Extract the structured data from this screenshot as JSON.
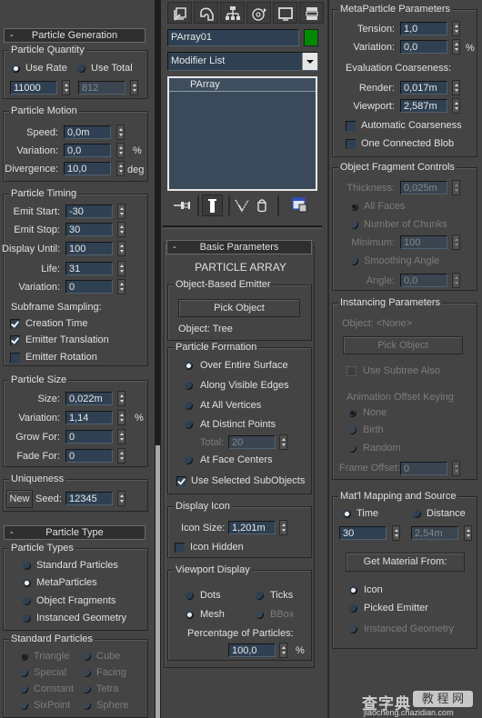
{
  "command_tabs": [
    {
      "name": "create-tab",
      "icon": "create-icon"
    },
    {
      "name": "modify-tab",
      "icon": "modify-icon"
    },
    {
      "name": "hierarchy-tab",
      "icon": "hierarchy-icon"
    },
    {
      "name": "motion-tab",
      "icon": "motion-icon"
    },
    {
      "name": "display-tab",
      "icon": "display-icon"
    },
    {
      "name": "utilities-tab",
      "icon": "utilities-icon"
    }
  ],
  "object": {
    "name": "PArray01",
    "color": "#008a00"
  },
  "modifier_list": {
    "label": "Modifier List"
  },
  "modifier_stack": {
    "items": [
      "PArray"
    ]
  },
  "stack_toolbar": [
    "pin-stack-icon",
    "show-end-result-icon",
    "make-unique-icon",
    "remove-modifier-icon",
    "configure-modifier-sets-icon"
  ],
  "particle_generation": {
    "title": "Particle Generation",
    "collapse": "-",
    "quantity": {
      "title": "Particle Quantity",
      "use_rate": "Use Rate",
      "use_total": "Use Total",
      "rate_value": "11000",
      "total_value": "812",
      "selected": "use_rate"
    },
    "motion": {
      "title": "Particle Motion",
      "speed_label": "Speed:",
      "speed": "0,0m",
      "variation_label": "Variation:",
      "variation": "0,0",
      "variation_unit": "%",
      "divergence_label": "Divergence:",
      "divergence": "10,0",
      "divergence_unit": "deg"
    },
    "timing": {
      "title": "Particle Timing",
      "emit_start_label": "Emit Start:",
      "emit_start": "-30",
      "emit_stop_label": "Emit Stop:",
      "emit_stop": "30",
      "display_until_label": "Display Until:",
      "display_until": "100",
      "life_label": "Life:",
      "life": "31",
      "variation_label": "Variation:",
      "variation": "0",
      "subframe_label": "Subframe Sampling:",
      "creation_time": "Creation Time",
      "creation_time_checked": true,
      "emitter_translation": "Emitter Translation",
      "emitter_translation_checked": true,
      "emitter_rotation": "Emitter Rotation",
      "emitter_rotation_checked": false
    },
    "size": {
      "title": "Particle Size",
      "size_label": "Size:",
      "size": "0,022m",
      "variation_label": "Variation:",
      "variation": "1,14",
      "variation_unit": "%",
      "grow_label": "Grow For:",
      "grow": "0",
      "fade_label": "Fade For:",
      "fade": "0"
    },
    "uniqueness": {
      "title": "Uniqueness",
      "new_label": "New",
      "seed_label": "Seed:",
      "seed": "12345"
    }
  },
  "particle_type": {
    "title": "Particle Type",
    "collapse": "-",
    "types": {
      "title": "Particle Types",
      "options": [
        "Standard Particles",
        "MetaParticles",
        "Object Fragments",
        "Instanced Geometry"
      ],
      "selected": "MetaParticles"
    },
    "standard": {
      "title": "Standard Particles",
      "options": [
        "Triangle",
        "Cube",
        "Special",
        "Facing",
        "Constant",
        "Tetra",
        "SixPoint",
        "Sphere"
      ],
      "selected": "Triangle"
    }
  },
  "basic_parameters": {
    "title": "Basic Parameters",
    "collapse": "-",
    "heading": "PARTICLE ARRAY",
    "emitter": {
      "title": "Object-Based Emitter",
      "pick_label": "Pick Object",
      "object_text": "Object: Tree"
    },
    "formation": {
      "title": "Particle Formation",
      "options": [
        "Over Entire Surface",
        "Along Visible Edges",
        "At All Vertices",
        "At Distinct Points",
        "At Face Centers"
      ],
      "selected": "Over Entire Surface",
      "total_label": "Total:",
      "total": "20",
      "use_selected": "Use Selected SubObjects",
      "use_selected_checked": true
    },
    "display_icon": {
      "title": "Display Icon",
      "icon_size_label": "Icon Size:",
      "icon_size": "1,201m",
      "icon_hidden": "Icon Hidden",
      "icon_hidden_checked": false
    },
    "viewport_display": {
      "title": "Viewport Display",
      "options": [
        "Dots",
        "Ticks",
        "Mesh",
        "BBox"
      ],
      "selected": "Mesh",
      "percentage_label": "Percentage of Particles:",
      "percentage": "100,0",
      "percentage_unit": "%"
    }
  },
  "metaparticle": {
    "title": "MetaParticle Parameters",
    "tension_label": "Tension:",
    "tension": "1,0",
    "variation_label": "Variation:",
    "variation": "0,0",
    "variation_unit": "%",
    "coarseness_label": "Evaluation Coarseness:",
    "render_label": "Render:",
    "render": "0,017m",
    "viewport_label": "Viewport:",
    "viewport": "2,587m",
    "automatic": "Automatic Coarseness",
    "automatic_checked": false,
    "one_blob": "One Connected Blob",
    "one_blob_checked": false
  },
  "fragment_controls": {
    "title": "Object Fragment Controls",
    "thickness_label": "Thickness:",
    "thickness": "0,025m",
    "all_faces": "All Faces",
    "chunks": "Number of Chunks",
    "minimum_label": "Minimum:",
    "minimum": "100",
    "smoothing": "Smoothing Angle",
    "angle_label": "Angle:",
    "angle": "0,0",
    "selected": "All Faces"
  },
  "instancing": {
    "title": "Instancing Parameters",
    "object_text": "Object: <None>",
    "pick_label": "Pick Object",
    "use_subtree": "Use Subtree Also",
    "offset_keying": "Animation Offset Keying",
    "options": [
      "None",
      "Birth",
      "Random"
    ],
    "selected": "None",
    "frame_offset_label": "Frame Offset:",
    "frame_offset": "0"
  },
  "material_mapping": {
    "title": "Mat'l Mapping and Source",
    "time": "Time",
    "distance": "Distance",
    "selected_mode": "Time",
    "time_value": "30",
    "distance_value": "2,54m",
    "get_material": "Get Material From:",
    "options": [
      "Icon",
      "Picked Emitter",
      "Instanced Geometry"
    ],
    "selected": "Icon"
  },
  "watermark": {
    "title": "查字典",
    "badge": "教 程 网",
    "url": "jiaocheng.chazidian.com"
  }
}
